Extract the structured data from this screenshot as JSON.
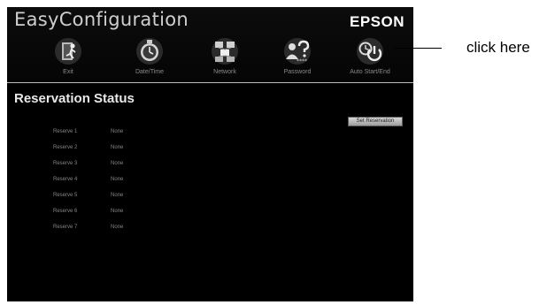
{
  "header": {
    "app_title": "EasyConfiguration",
    "brand": "EPSON"
  },
  "nav": [
    {
      "label": "Exit",
      "icon": "exit-icon"
    },
    {
      "label": "Date/Time",
      "icon": "clock-icon"
    },
    {
      "label": "Network",
      "icon": "network-icon"
    },
    {
      "label": "Password",
      "icon": "password-icon"
    },
    {
      "label": "Auto Start/End",
      "icon": "power-timer-icon"
    }
  ],
  "main": {
    "title": "Reservation Status",
    "set_button_label": "Set Reservation",
    "reservations": [
      {
        "name": "Reserve 1",
        "status": "None"
      },
      {
        "name": "Reserve 2",
        "status": "None"
      },
      {
        "name": "Reserve 3",
        "status": "None"
      },
      {
        "name": "Reserve 4",
        "status": "None"
      },
      {
        "name": "Reserve 5",
        "status": "None"
      },
      {
        "name": "Reserve 6",
        "status": "None"
      },
      {
        "name": "Reserve 7",
        "status": "None"
      }
    ]
  },
  "callout": {
    "text": "click here"
  },
  "colors": {
    "background": "#000000",
    "text_dim": "#858585",
    "accent_button": "#c8c8c8"
  }
}
